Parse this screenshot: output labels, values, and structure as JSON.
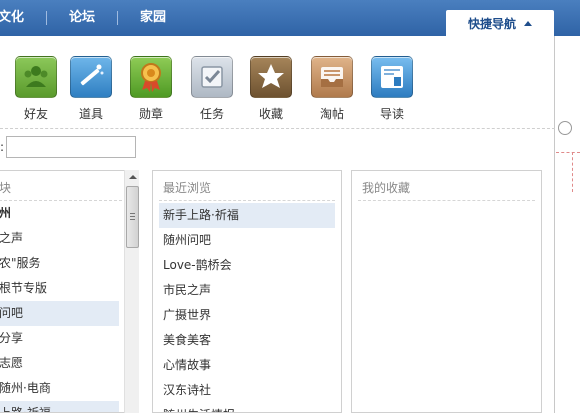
{
  "topnav": {
    "items": [
      "文化",
      "论坛",
      "家园"
    ]
  },
  "quicknav": {
    "label": "快捷导航"
  },
  "tools": [
    {
      "label": "好友",
      "icon": "friends-icon",
      "color": "#6aa83a"
    },
    {
      "label": "道具",
      "icon": "magic-wand-icon",
      "color": "#3f8fd0"
    },
    {
      "label": "勋章",
      "icon": "medal-icon",
      "color": "#6fb13c"
    },
    {
      "label": "任务",
      "icon": "task-check-icon",
      "color": "#b9c3cf"
    },
    {
      "label": "收藏",
      "icon": "star-icon",
      "color": "#8a6b3d"
    },
    {
      "label": "淘帖",
      "icon": "tray-icon",
      "color": "#c9956a"
    },
    {
      "label": "导读",
      "icon": "reading-guide-icon",
      "color": "#3f8fd0"
    }
  ],
  "search": {
    "colon": ":",
    "placeholder": ""
  },
  "col1": {
    "header": "块",
    "items": [
      "州",
      "之声",
      "农\"服务",
      "根节专版",
      "问吧",
      "分享",
      "志愿",
      "随州·电商",
      "上路·祈福"
    ]
  },
  "col2": {
    "header": "最近浏览",
    "items": [
      "新手上路·祈福",
      "随州问吧",
      "Love-鹊桥会",
      "市民之声",
      "广摄世界",
      "美食美客",
      "心情故事",
      "汉东诗社",
      "随州生活情报"
    ]
  },
  "col3": {
    "header": "我的收藏"
  },
  "colors": {
    "topbar": "#3a6fb3",
    "selected_row": "#e3ebf5"
  }
}
